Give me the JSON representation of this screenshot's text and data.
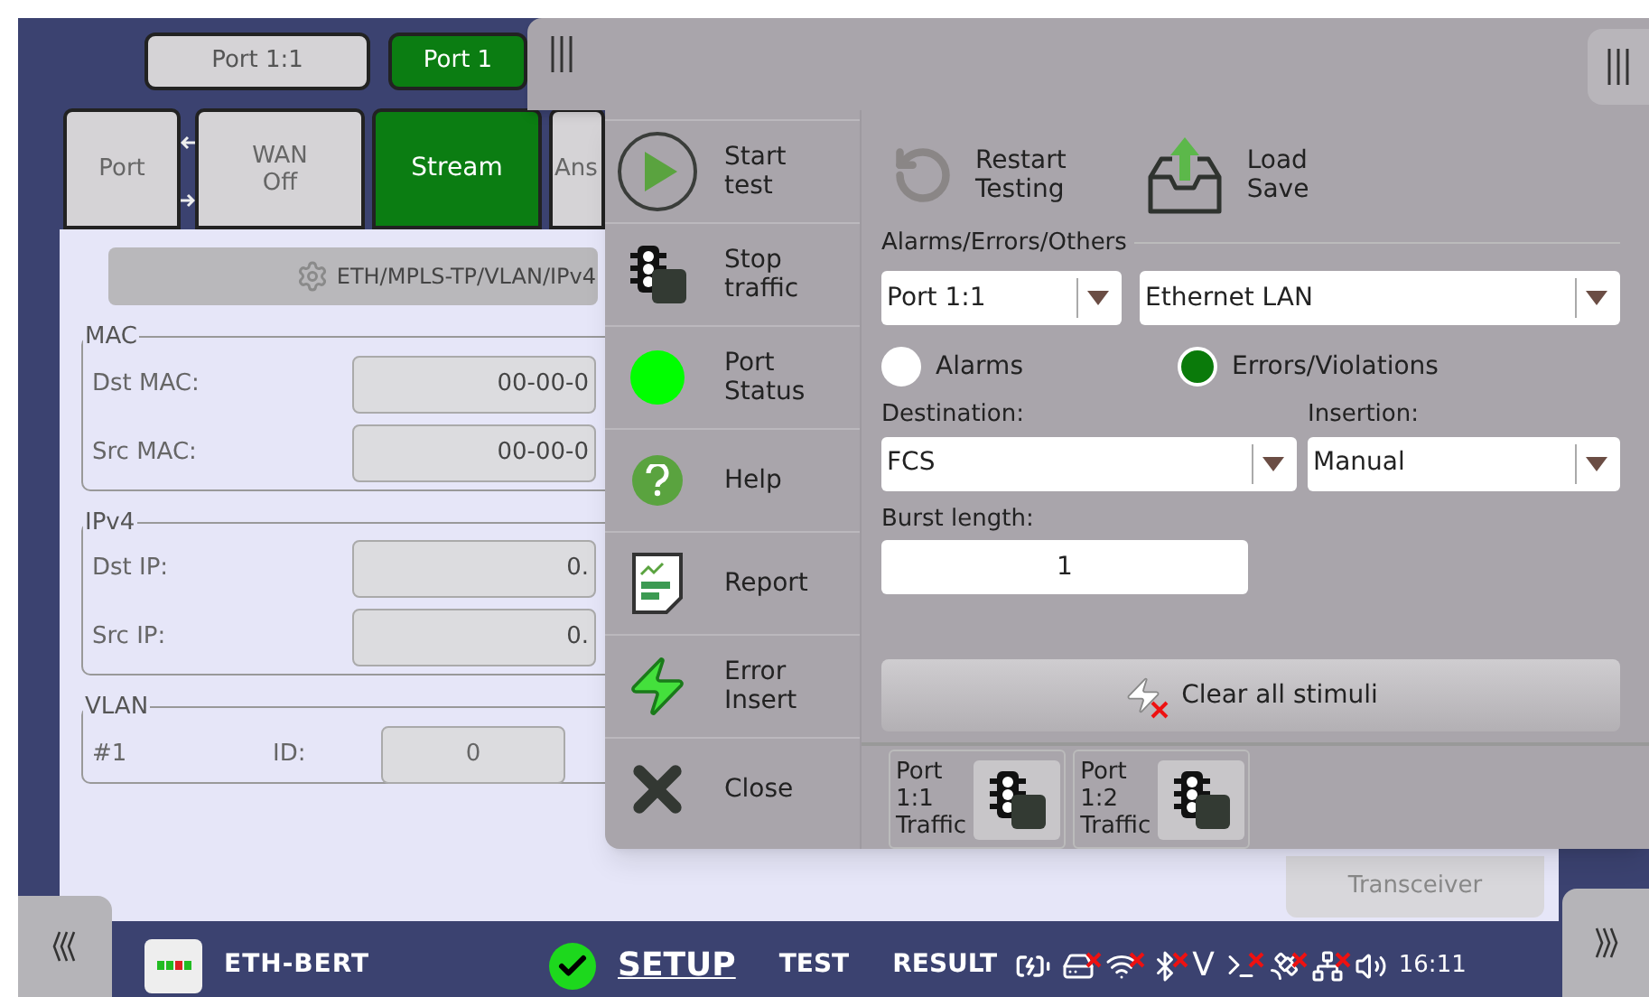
{
  "port_tabs": [
    {
      "label": "Port 1:1",
      "selected": false
    },
    {
      "label": "Port 1",
      "selected": true
    }
  ],
  "function_tabs": [
    {
      "label": "Port",
      "selected": false
    },
    {
      "label": "WAN\nOff",
      "selected": false
    },
    {
      "label": "Stream",
      "selected": true
    },
    {
      "label": "Ans",
      "selected": false
    }
  ],
  "setup_button": "ETH/MPLS-TP/VLAN/IPv4",
  "groups": [
    {
      "title": "MAC",
      "fields": [
        {
          "label": "Dst MAC:",
          "value": "00-00-0"
        },
        {
          "label": "Src MAC:",
          "value": "00-00-0"
        }
      ]
    },
    {
      "title": "IPv4",
      "fields": [
        {
          "label": "Dst IP:",
          "value": "0."
        },
        {
          "label": "Src IP:",
          "value": "0."
        }
      ]
    }
  ],
  "vlan": {
    "title": "VLAN",
    "index": "#1",
    "id_label": "ID:",
    "id_value": "0"
  },
  "transceiver_button": "Transceiver",
  "side_menu": [
    {
      "kind": "start",
      "label": "Start\ntest"
    },
    {
      "kind": "stop",
      "label": "Stop\ntraffic"
    },
    {
      "kind": "status",
      "label": "Port\nStatus"
    },
    {
      "kind": "help",
      "label": "Help"
    },
    {
      "kind": "report",
      "label": "Report"
    },
    {
      "kind": "error",
      "label": "Error\nInsert"
    },
    {
      "kind": "close",
      "label": "Close"
    }
  ],
  "actions": [
    {
      "kind": "restart",
      "label": "Restart\nTesting"
    },
    {
      "kind": "load",
      "label": "Load\nSave"
    }
  ],
  "alarms": {
    "title": "Alarms/Errors/Others",
    "port_select": "Port 1:1",
    "type_select": "Ethernet LAN",
    "options": [
      {
        "label": "Alarms",
        "selected": false
      },
      {
        "label": "Errors/Violations",
        "selected": true
      }
    ],
    "destination": {
      "label": "Destination:",
      "value": "FCS"
    },
    "insertion": {
      "label": "Insertion:",
      "value": "Manual"
    },
    "burst": {
      "label": "Burst length:",
      "value": "1"
    }
  },
  "clear_button": "Clear all stimuli",
  "traffic_buttons": [
    {
      "label": "Port\n1:1\nTraffic"
    },
    {
      "label": "Port\n1:2\nTraffic"
    }
  ],
  "bottom_bar": {
    "app": "ETH-BERT",
    "tabs": [
      {
        "label": "SETUP",
        "selected": true
      },
      {
        "label": "TEST",
        "selected": false
      },
      {
        "label": "RESULT",
        "selected": false
      }
    ],
    "status_letter": "V",
    "time": "16:11"
  }
}
